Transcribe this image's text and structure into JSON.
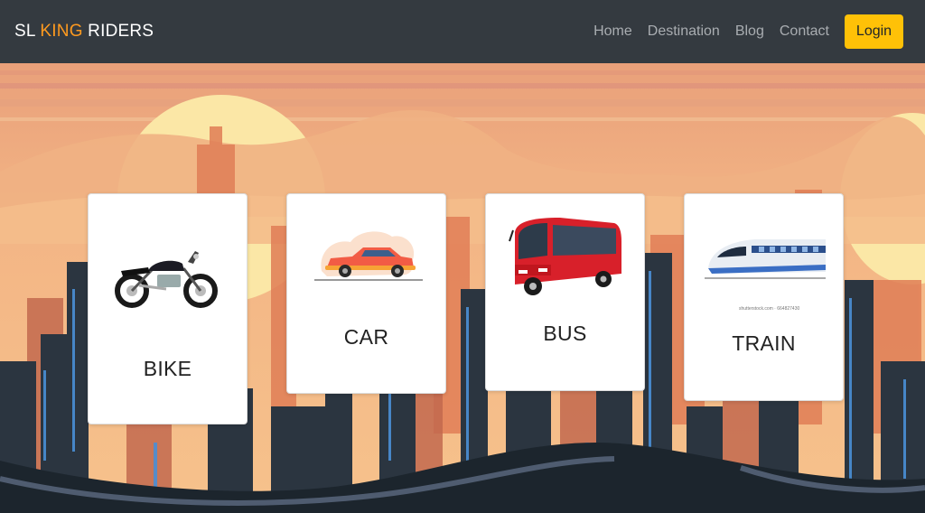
{
  "brand": {
    "part1": "SL ",
    "part2": "KING",
    "part3": " RIDERS"
  },
  "nav": {
    "links": [
      "Home",
      "Destination",
      "Blog",
      "Contact"
    ],
    "login_label": "Login"
  },
  "cards": [
    {
      "label": "BIKE",
      "image": "motorcycle-icon"
    },
    {
      "label": "CAR",
      "image": "car-icon"
    },
    {
      "label": "BUS",
      "image": "bus-icon"
    },
    {
      "label": "TRAIN",
      "image": "train-icon"
    }
  ],
  "stock_caption": "shutterstock.com · 664827430",
  "colors": {
    "navbar": "#343a40",
    "accent": "#ff9a1f",
    "login_button": "#ffc107",
    "sky": "#f2b07a"
  }
}
